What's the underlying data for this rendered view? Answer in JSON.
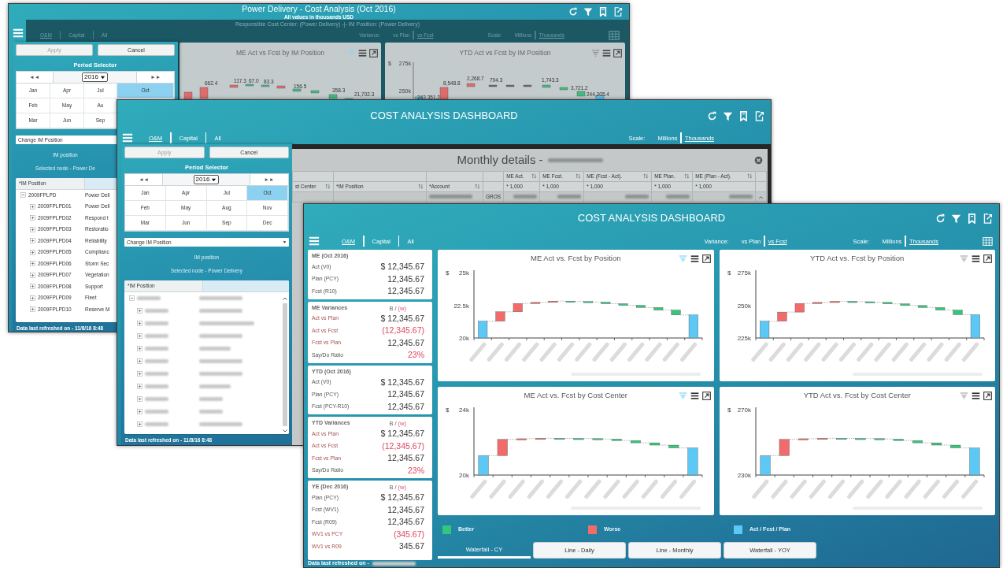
{
  "back_window": {
    "title": "Power Delivery - Cost Analysis (Oct 2016)",
    "subtitle": "All values in thousands USD",
    "context": "Responsible Cost Center: (Power Delivery) -|- IM Position: (Power Delivery)",
    "tabs": [
      {
        "label": "O&M",
        "selected": true
      },
      {
        "label": "Capital",
        "selected": false
      },
      {
        "label": "All",
        "selected": false
      }
    ],
    "variance": {
      "label": "Variance:",
      "options": [
        {
          "label": "vs Plan",
          "selected": false
        },
        {
          "label": "vs Fcst",
          "selected": true
        }
      ]
    },
    "scale": {
      "label": "Scale:",
      "options": [
        {
          "label": "Millions",
          "selected": false
        },
        {
          "label": "Thousands",
          "selected": true
        }
      ]
    },
    "charts": [
      {
        "title": "ME Act vs Fcst by IM Position",
        "filter_active": true,
        "data_labels": [
          "662.4",
          "117.3",
          "67.0",
          "83.3",
          "156.5",
          "358.3",
          "21,702.3"
        ]
      },
      {
        "title": "YTD Act vs Fcst by IM Position",
        "filter_active": false,
        "ylabel": "$",
        "ticks": [
          "275k",
          "250k"
        ],
        "data_labels": [
          "243,351.2",
          "8,548.8",
          "2,268.7",
          "794.3",
          "1,743.3",
          "3,721.2",
          "244,205.4"
        ]
      }
    ],
    "panel": {
      "apply": "Apply",
      "cancel": "Cancel",
      "period_title": "Period Selector",
      "prev": "◄◄",
      "year": "2016",
      "next": "►►",
      "month_rows": [
        [
          {
            "label": "Jan",
            "selected": false
          },
          {
            "label": "Apr",
            "selected": false
          },
          {
            "label": "Jul",
            "selected": false
          },
          {
            "label": "Oct",
            "selected": true
          }
        ],
        [
          {
            "label": "Feb",
            "selected": false
          },
          {
            "label": "May",
            "selected": false
          },
          {
            "label": "Au",
            "selected": false
          }
        ],
        [
          {
            "label": "Mar",
            "selected": false
          },
          {
            "label": "Jun",
            "selected": false
          },
          {
            "label": "Sep",
            "selected": false
          }
        ]
      ],
      "dropdown": "Change IM Position",
      "im_label": "IM position",
      "selected_node": "Selected node - Power De",
      "tree": {
        "column_1": "*IM Position",
        "nodes": [
          {
            "code": "2009FPLPD",
            "name": "Power Dell",
            "expanded": true,
            "children": [
              {
                "code": "2009FPLPD01",
                "name": "Power Dell",
                "expanded": false
              },
              {
                "code": "2009FPLPD02",
                "name": "Respond t",
                "expanded": false
              },
              {
                "code": "2009FPLPD03",
                "name": "Restoratio",
                "expanded": false
              },
              {
                "code": "2009FPLPD04",
                "name": "Reliability",
                "expanded": false
              },
              {
                "code": "2009FPLPD05",
                "name": "Complianc",
                "expanded": false
              },
              {
                "code": "2009FPLPD06",
                "name": "Storm Sec",
                "expanded": false
              },
              {
                "code": "2009FPLPD07",
                "name": "Vegetation",
                "expanded": false
              },
              {
                "code": "2009FPLPD08",
                "name": "Support",
                "expanded": false
              },
              {
                "code": "2009FPLPD09",
                "name": "Fleet",
                "expanded": false
              },
              {
                "code": "2009FPLPD10",
                "name": "Reserve M",
                "expanded": false
              }
            ]
          }
        ]
      }
    },
    "footer": "Data last refreshed on - 11/8/16 8:48"
  },
  "middle_window": {
    "title": "COST ANALYSIS DASHBOARD",
    "tabs": [
      {
        "label": "O&M",
        "selected": true
      },
      {
        "label": "Capital",
        "selected": false
      },
      {
        "label": "All",
        "selected": false
      }
    ],
    "scale": {
      "label": "Scale:",
      "options": [
        {
          "label": "Millions",
          "selected": false
        },
        {
          "label": "Thousands",
          "selected": true
        }
      ]
    },
    "modal": {
      "title": "Monthly details - ",
      "columns_top": [
        "ME Act.",
        "ME Fcst.",
        "ME (Fcst - Act).",
        "ME Plan.",
        "ME (Plan - Act)."
      ],
      "columns_left": [
        "st Center",
        "*IM Position",
        "*Account"
      ],
      "units": [
        "* 1,000",
        "* 1,000",
        "* 1,000",
        "* 1,000",
        "* 1,000"
      ],
      "row_fragment": "GROS"
    },
    "panel": {
      "apply": "Apply",
      "cancel": "Cancel",
      "period_title": "Period Selector",
      "prev": "◄◄",
      "year": "2016",
      "next": "►►",
      "month_rows": [
        [
          {
            "label": "Jan",
            "selected": false
          },
          {
            "label": "Apr",
            "selected": false
          },
          {
            "label": "Jul",
            "selected": false
          },
          {
            "label": "Oct",
            "selected": true
          }
        ],
        [
          {
            "label": "Feb",
            "selected": false
          },
          {
            "label": "May",
            "selected": false
          },
          {
            "label": "Aug",
            "selected": false
          },
          {
            "label": "Nov",
            "selected": false
          }
        ],
        [
          {
            "label": "Mar",
            "selected": false
          },
          {
            "label": "Jun",
            "selected": false
          },
          {
            "label": "Sep",
            "selected": false
          },
          {
            "label": "Dec",
            "selected": false
          }
        ]
      ],
      "dropdown": "Change IM Position",
      "im_label": "IM position",
      "selected_node": "Selected node - Power Delivery",
      "tree": {
        "column_1": "*IM Position"
      }
    },
    "footer": "Data last refreshed on - 11/8/16 8:48"
  },
  "front_window": {
    "title": "COST ANALYSIS DASHBOARD",
    "tabs": [
      {
        "label": "O&M",
        "selected": true
      },
      {
        "label": "Capital",
        "selected": false
      },
      {
        "label": "All",
        "selected": false
      }
    ],
    "variance": {
      "label": "Variance:",
      "options": [
        {
          "label": "vs Plan",
          "selected": false
        },
        {
          "label": "vs Fcst",
          "selected": true
        }
      ]
    },
    "scale": {
      "label": "Scale:",
      "options": [
        {
          "label": "Millions",
          "selected": false
        },
        {
          "label": "Thousands",
          "selected": true
        }
      ]
    },
    "summary_cards": [
      {
        "title": "ME (Oct 2016)",
        "rows": [
          {
            "label": "Act (V0)",
            "value": "$ 12,345.67",
            "kind": "plain",
            "alert": false
          },
          {
            "label": "Plan (PCY)",
            "value": "12,345.67",
            "kind": "plain",
            "alert": false
          },
          {
            "label": "Fcst (R10)",
            "value": "12,345.67",
            "kind": "plain",
            "alert": false
          }
        ]
      },
      {
        "title": "ME Variances",
        "better_key": "B /",
        "worse_key": "(w)",
        "rows": [
          {
            "label": "Act vs Plan",
            "value": "$ 12,345.67",
            "kind": "variance",
            "alert": false
          },
          {
            "label": "Act vs Fcst",
            "value": "(12,345.67)",
            "kind": "variance",
            "alert": true
          },
          {
            "label": "Fcst vs Plan",
            "value": "12,345.67",
            "kind": "variance",
            "alert": false
          },
          {
            "label": "Say/Do Ratio",
            "value": "23%",
            "kind": "plain",
            "alert": true
          }
        ]
      },
      {
        "title": "YTD (Oct 2016)",
        "rows": [
          {
            "label": "Act (V0)",
            "value": "$ 12,345.67",
            "kind": "plain",
            "alert": false
          },
          {
            "label": "Plan (PCY)",
            "value": "12,345.67",
            "kind": "plain",
            "alert": false
          },
          {
            "label": "Fcst (PCY-R10)",
            "value": "12,345.67",
            "kind": "plain",
            "alert": false
          }
        ]
      },
      {
        "title": "YTD Variances",
        "better_key": "B /",
        "worse_key": "(w)",
        "rows": [
          {
            "label": "Act vs Plan",
            "value": "$ 12,345.67",
            "kind": "variance",
            "alert": false
          },
          {
            "label": "Act vs Fcst",
            "value": "(12,345.67)",
            "kind": "variance",
            "alert": true
          },
          {
            "label": "Fcst vs Plan",
            "value": "12,345.67",
            "kind": "variance",
            "alert": false
          },
          {
            "label": "Say/Do Ratio",
            "value": "23%",
            "kind": "plain",
            "alert": true
          }
        ]
      },
      {
        "title": "YE (Dec 2016)",
        "better_key": "B /",
        "worse_key": "(w)",
        "rows": [
          {
            "label": "Plan (PCY)",
            "value": "$ 12,345.67",
            "kind": "plain",
            "alert": false
          },
          {
            "label": "Fcst (WV1)",
            "value": "12,345.67",
            "kind": "plain",
            "alert": false
          },
          {
            "label": "Fcst (R09)",
            "value": "12,345.67",
            "kind": "plain",
            "alert": false
          },
          {
            "label": "WV1 vs PCY",
            "value": "(345.67)",
            "kind": "variance",
            "alert": true
          },
          {
            "label": "WV1 vs R09",
            "value": "345.67",
            "kind": "variance",
            "alert": false
          }
        ]
      }
    ],
    "charts": [
      {
        "title": "ME Act vs. Fcst by Position",
        "filter_active": true,
        "ylabel": "$",
        "ticks": [
          "25k",
          "22.5k",
          "20k"
        ]
      },
      {
        "title": "YTD Act vs. Fcst by Position",
        "filter_active": false,
        "ylabel": "$",
        "ticks": [
          "275k",
          "250k",
          "225k"
        ]
      },
      {
        "title": "ME Act vs. Fcst by Cost Center",
        "filter_active": true,
        "ylabel": "$",
        "ticks": [
          "24k",
          "20k"
        ]
      },
      {
        "title": "YTD Act vs. Fcst by Cost Center",
        "filter_active": false,
        "ylabel": "$",
        "ticks": [
          "270k",
          "230k"
        ]
      }
    ],
    "legend": [
      {
        "label": "Better",
        "color": "#34c77b"
      },
      {
        "label": "Worse",
        "color": "#f26b6b"
      },
      {
        "label": "Act / Fcst / Plan",
        "color": "#5bc8f5"
      }
    ],
    "view_tabs": [
      {
        "label": "Waterfall - CY",
        "selected": true
      },
      {
        "label": "Line - Daily",
        "selected": false
      },
      {
        "label": "Line - Monthly",
        "selected": false
      },
      {
        "label": "Waterfall - YOY",
        "selected": false
      }
    ],
    "footer": "Data last refreshed on - "
  }
}
